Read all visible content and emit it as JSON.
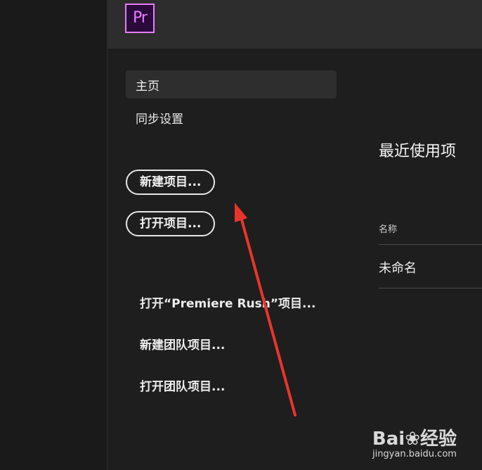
{
  "app": {
    "logo_text": "Pr",
    "accent_color": "#e77bff"
  },
  "nav": {
    "home_label": "主页",
    "sync_label": "同步设置"
  },
  "actions": {
    "new_project_label": "新建项目...",
    "open_project_label": "打开项目...",
    "open_rush_label": "打开“Premiere Rush”项目...",
    "new_team_label": "新建团队项目...",
    "open_team_label": "打开团队项目..."
  },
  "recent": {
    "title": "最近使用项",
    "column_name": "名称",
    "items": [
      "未命名"
    ]
  },
  "annotation": {
    "arrow_color": "#e8352b"
  },
  "watermark": {
    "brand_text": "Bai",
    "brand_suffix": "经验",
    "url": "jingyan.baidu.com"
  }
}
